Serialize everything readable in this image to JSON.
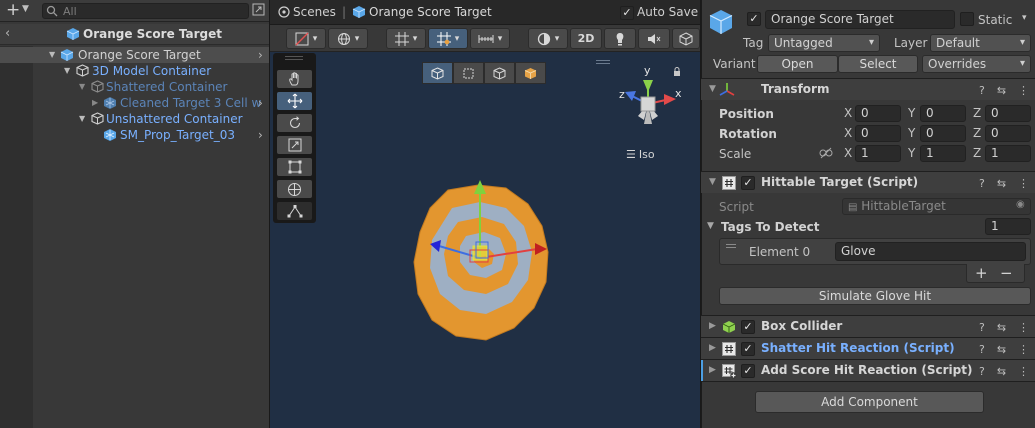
{
  "hierarchy": {
    "search_placeholder": "All",
    "scene_name": "Orange Score Target",
    "rows": [
      {
        "label": "Orange Score Target"
      },
      {
        "label": "3D Model Container"
      },
      {
        "label": "Shattered Container"
      },
      {
        "label": "Cleaned Target 3 Cell w"
      },
      {
        "label": "Unshattered Container"
      },
      {
        "label": "SM_Prop_Target_03"
      }
    ]
  },
  "scene": {
    "tab_scenes": "Scenes",
    "tab_prefab": "Orange Score Target",
    "auto_save_label": "Auto Save",
    "btn_2d": "2D",
    "gizmo_iso_label": "Iso",
    "gizmo_axes": {
      "y": "y",
      "x": "x",
      "z": "z"
    }
  },
  "inspector": {
    "object_name": "Orange Score Target",
    "static_label": "Static",
    "tag_label": "Tag",
    "tag_value": "Untagged",
    "layer_label": "Layer",
    "layer_value": "Default",
    "variant_label": "Variant",
    "open_btn": "Open",
    "select_btn": "Select",
    "overrides_btn": "Overrides",
    "transform": {
      "title": "Transform",
      "position_label": "Position",
      "rotation_label": "Rotation",
      "scale_label": "Scale",
      "axis_x": "X",
      "axis_y": "Y",
      "axis_z": "Z",
      "position": [
        "0",
        "0",
        "0"
      ],
      "rotation": [
        "0",
        "0",
        "0"
      ],
      "scale": [
        "1",
        "1",
        "1"
      ]
    },
    "hittable": {
      "title": "Hittable Target (Script)",
      "script_label": "Script",
      "script_value": "HittableTarget",
      "tags_label": "Tags To Detect",
      "tags_count": "1",
      "element_label": "Element 0",
      "element_value": "Glove",
      "plus": "+",
      "minus": "−",
      "simulate_btn": "Simulate Glove Hit"
    },
    "box_collider": "Box Collider",
    "shatter": "Shatter Hit Reaction (Script)",
    "add_score": "Add Score Hit Reaction (Script)",
    "add_component": "Add Component"
  },
  "colors": {
    "accent_blue": "#79b0ff",
    "scene_bg": "#202f44",
    "target_orange": "#e3962f",
    "target_grey": "#9eafc3"
  }
}
